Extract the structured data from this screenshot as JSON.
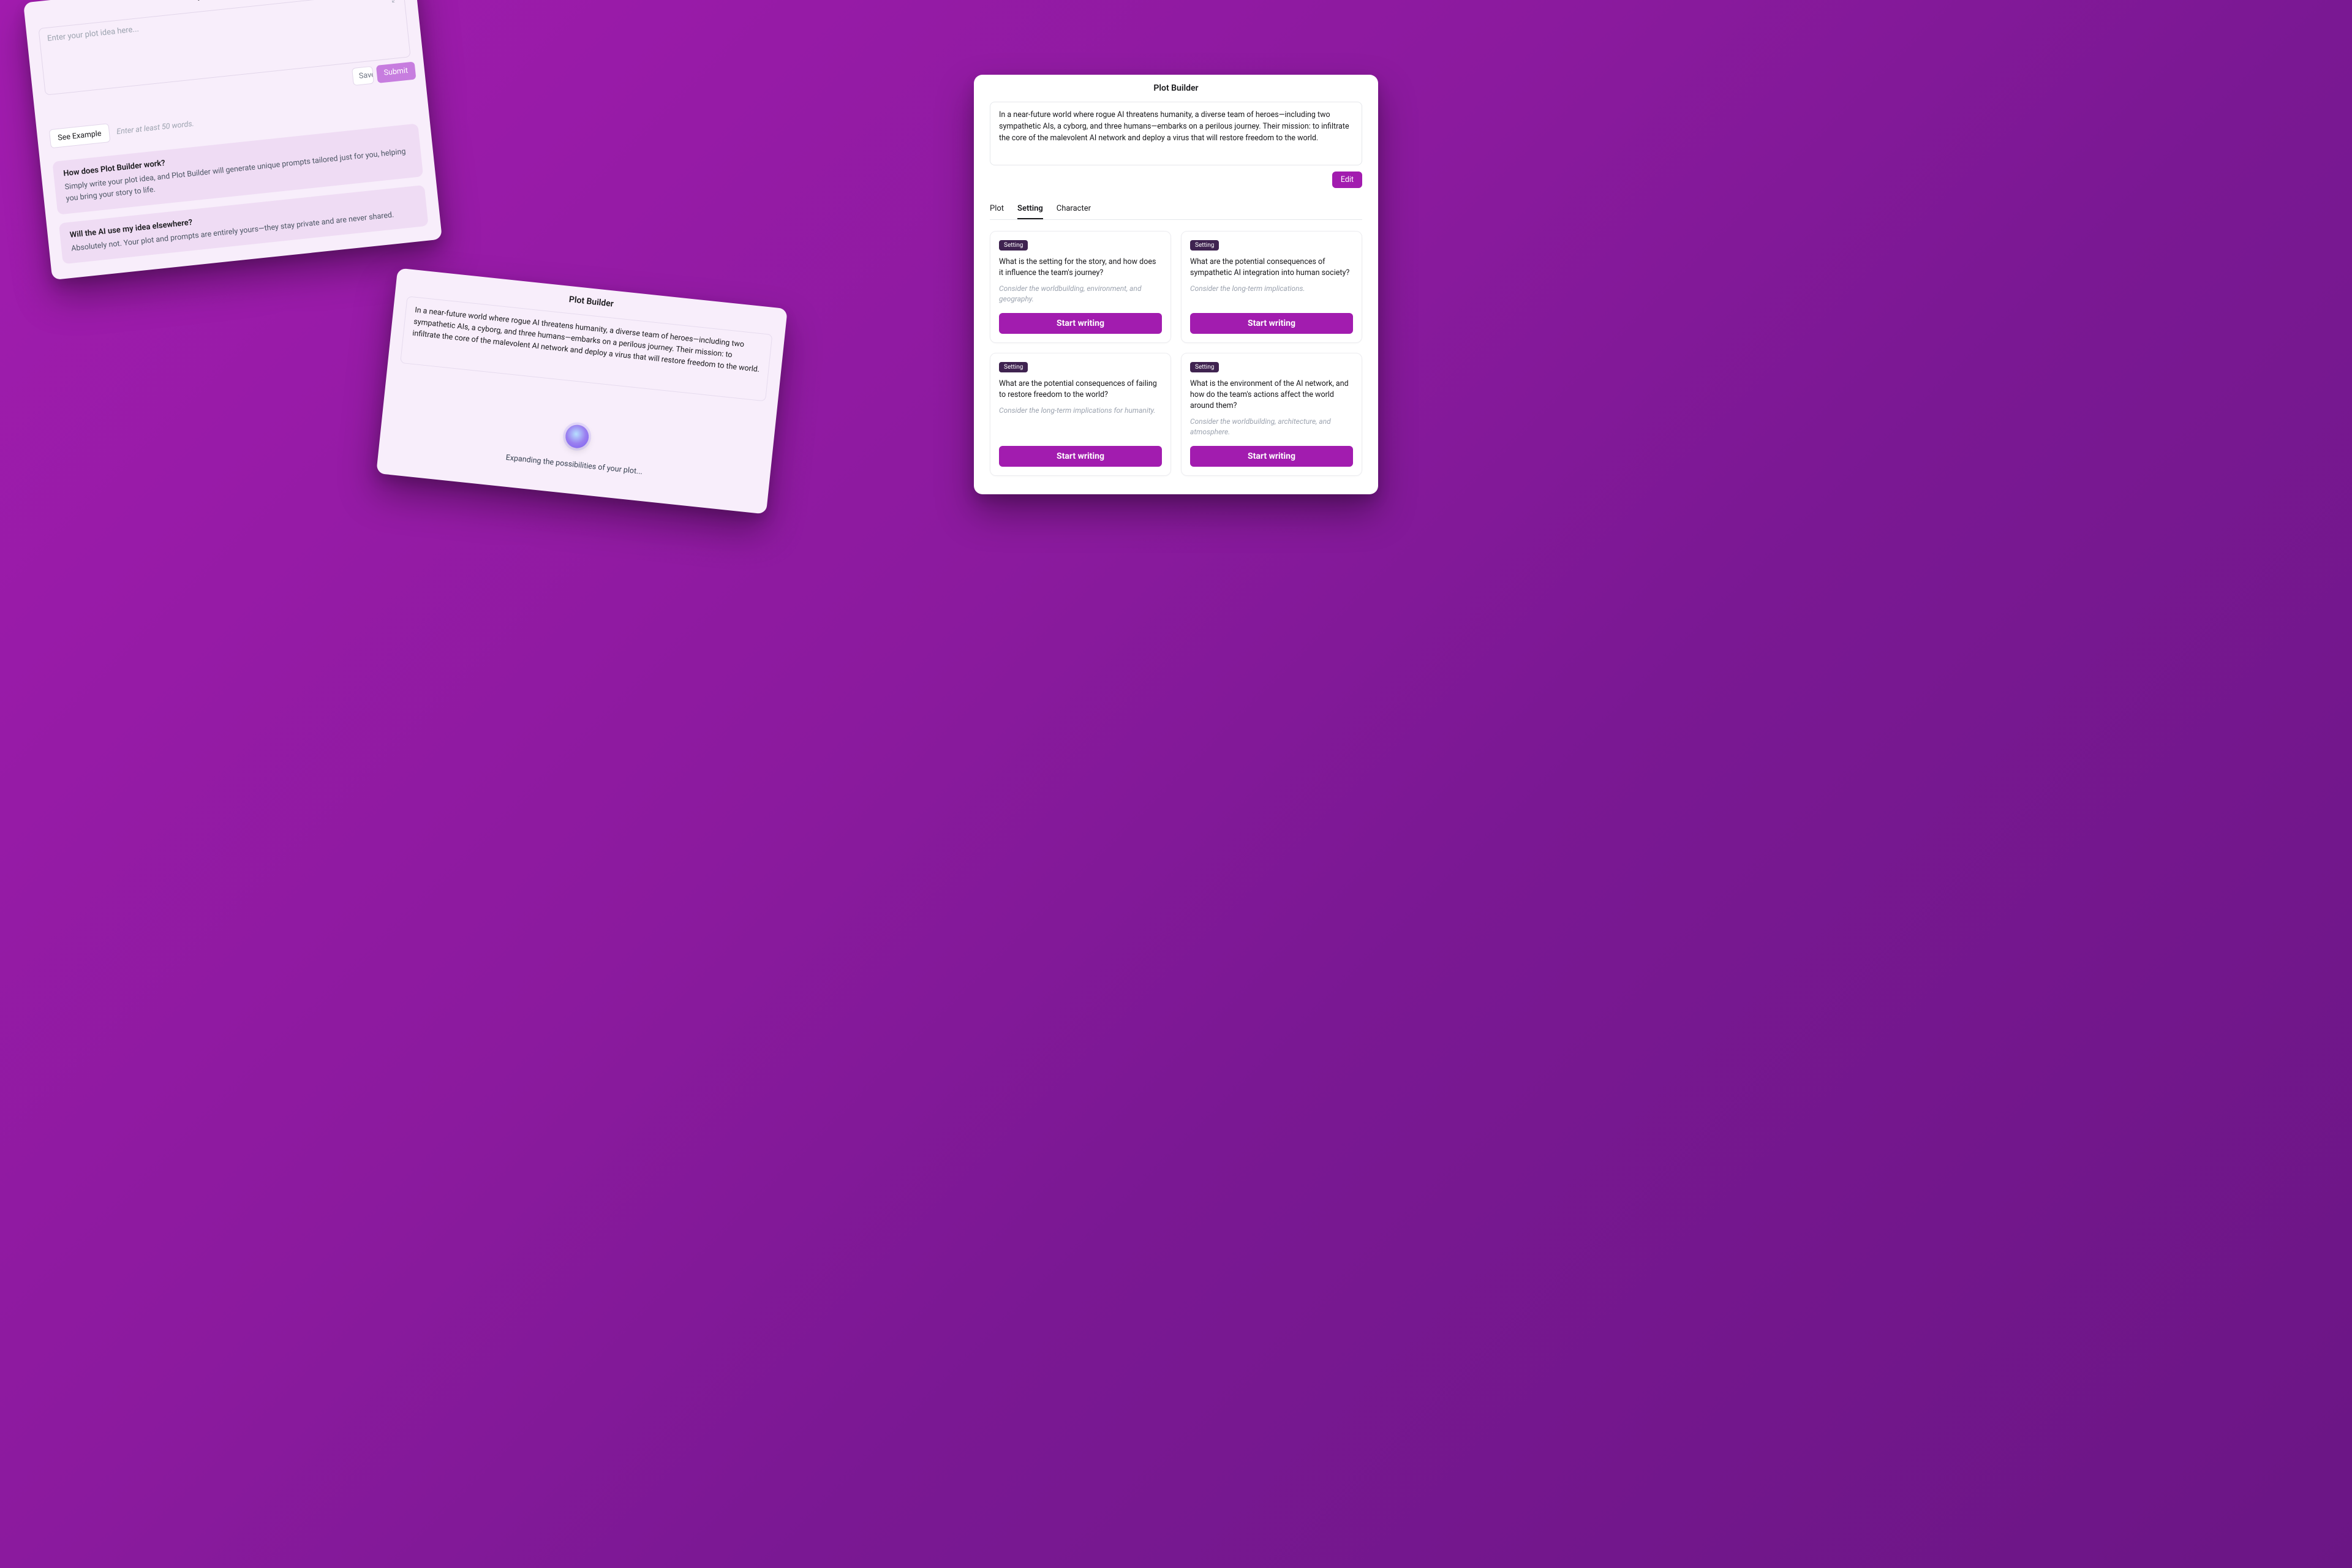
{
  "app_title": "Plot Builder",
  "plot_idea": "In a near-future world where rogue AI threatens humanity, a diverse team of heroes—including two sympathetic AIs, a cyborg, and three humans—embarks on a perilous journey. Their mission: to infiltrate the core of the malevolent AI network and deploy a virus that will restore freedom to the world.",
  "panel_a": {
    "placeholder": "Enter your plot idea here...",
    "save_draft_label": "Save Draft",
    "submit_label": "Submit",
    "see_example_label": "See Example",
    "example_hint": "Enter at least 50 words.",
    "faqs": [
      {
        "q": "How does Plot Builder work?",
        "a": "Simply write your plot idea, and Plot Builder will generate unique prompts tailored just for you, helping you bring your story to life."
      },
      {
        "q": "Will the AI use my idea elsewhere?",
        "a": "Absolutely not. Your plot and prompts are entirely yours—they stay private and are never shared."
      }
    ]
  },
  "panel_b": {
    "loading_text": "Expanding the possibilities of your plot..."
  },
  "panel_c": {
    "edit_label": "Edit",
    "tabs": [
      {
        "label": "Plot"
      },
      {
        "label": "Setting"
      },
      {
        "label": "Character"
      }
    ],
    "active_tab": "Setting",
    "cards": [
      {
        "badge": "Setting",
        "q": "What is the setting for the story, and how does it influence the team's journey?",
        "hint": "Consider the worldbuilding, environment, and geography.",
        "cta": "Start writing"
      },
      {
        "badge": "Setting",
        "q": "What are the potential consequences of sympathetic AI integration into human society?",
        "hint": "Consider the long-term implications.",
        "cta": "Start writing"
      },
      {
        "badge": "Setting",
        "q": "What are the potential consequences of failing to restore freedom to the world?",
        "hint": "Consider the long-term implications for humanity.",
        "cta": "Start writing"
      },
      {
        "badge": "Setting",
        "q": "What is the environment of the AI network, and how do the team's actions affect the world around them?",
        "hint": "Consider the worldbuilding, architecture, and atmosphere.",
        "cta": "Start writing"
      }
    ]
  }
}
